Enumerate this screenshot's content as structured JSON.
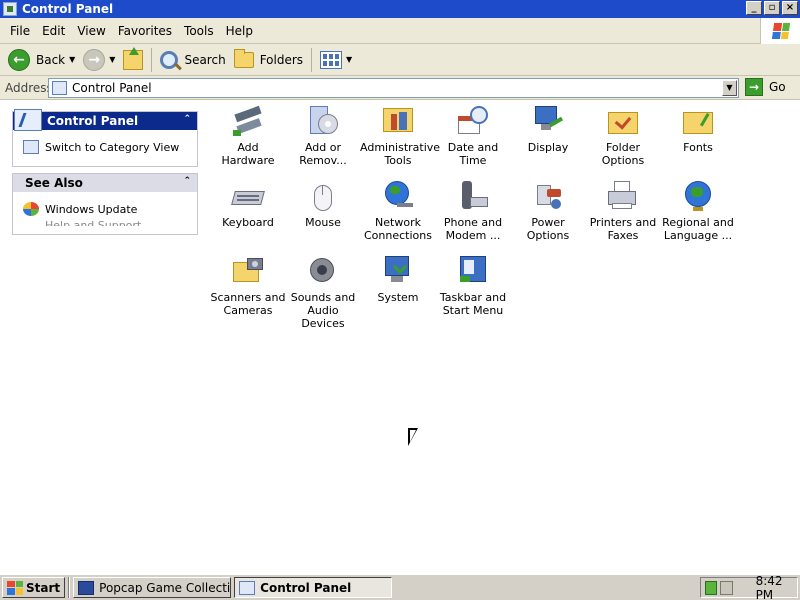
{
  "window": {
    "title": "Control Panel",
    "controls": [
      "minimize",
      "maximize",
      "close"
    ]
  },
  "menu": [
    "File",
    "Edit",
    "View",
    "Favorites",
    "Tools",
    "Help"
  ],
  "toolbar": {
    "back_label": "Back",
    "search_label": "Search",
    "folders_label": "Folders"
  },
  "address": {
    "label": "Address",
    "value": "Control Panel",
    "go_label": "Go"
  },
  "taskpane": {
    "control_panel_title": "Control Panel",
    "switch_label": "Switch to Category View",
    "see_also_title": "See Also",
    "windows_update_label": "Windows Update",
    "truncated_label": "Help and Support"
  },
  "icons": [
    {
      "label": "Add Hardware",
      "icon": "add-hardware-icon"
    },
    {
      "label": "Add or Remov...",
      "icon": "add-remove-programs-icon"
    },
    {
      "label": "Administrative Tools",
      "icon": "administrative-tools-icon"
    },
    {
      "label": "Date and Time",
      "icon": "date-time-icon"
    },
    {
      "label": "Display",
      "icon": "display-icon"
    },
    {
      "label": "Folder Options",
      "icon": "folder-options-icon"
    },
    {
      "label": "Fonts",
      "icon": "fonts-icon"
    },
    {
      "label": "Keyboard",
      "icon": "keyboard-icon"
    },
    {
      "label": "Mouse",
      "icon": "mouse-icon"
    },
    {
      "label": "Network Connections",
      "icon": "network-connections-icon"
    },
    {
      "label": "Phone and Modem ...",
      "icon": "phone-modem-icon"
    },
    {
      "label": "Power Options",
      "icon": "power-options-icon"
    },
    {
      "label": "Printers and Faxes",
      "icon": "printers-faxes-icon"
    },
    {
      "label": "Regional and Language ...",
      "icon": "regional-language-icon"
    },
    {
      "label": "Scanners and Cameras",
      "icon": "scanners-cameras-icon"
    },
    {
      "label": "Sounds and Audio Devices",
      "icon": "sounds-audio-icon"
    },
    {
      "label": "System",
      "icon": "system-icon"
    },
    {
      "label": "Taskbar and Start Menu",
      "icon": "taskbar-start-menu-icon"
    }
  ],
  "taskbar": {
    "start_label": "Start",
    "tasks": [
      {
        "label": "Popcap Game Collection -...",
        "active": false
      },
      {
        "label": "Control Panel",
        "active": true
      }
    ],
    "clock": "8:42 PM"
  }
}
